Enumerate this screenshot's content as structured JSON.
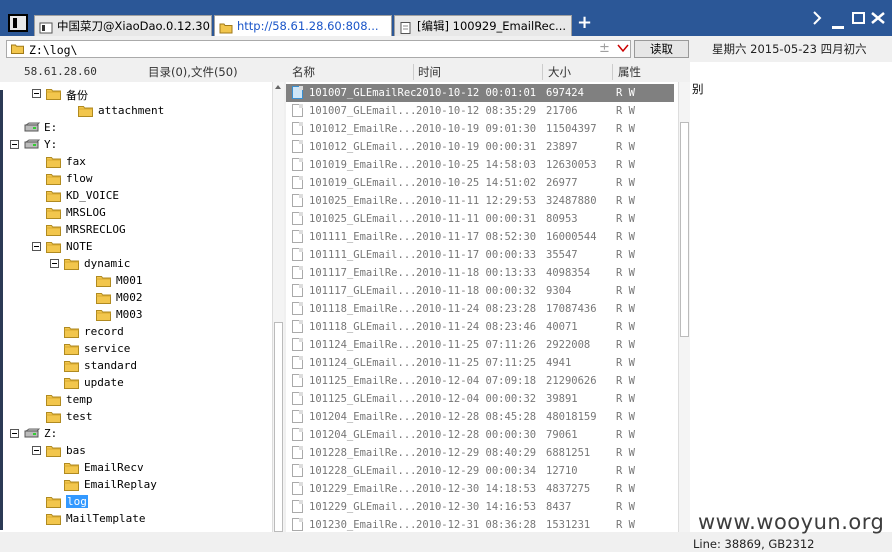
{
  "tabs": [
    {
      "label": "中国菜刀@XiaoDao.0.12.30"
    },
    {
      "label": "http://58.61.28.60:808..."
    },
    {
      "label": "[编辑] 100929_EmailRec..."
    }
  ],
  "tabs_new_label": "+",
  "path": {
    "value": "Z:\\log\\",
    "plus": "±",
    "read_button": "读取"
  },
  "date_text": "星期六 2015-05-23 四月初六",
  "left": {
    "host": "58.61.28.60",
    "dir_status": "目录(0),文件(50)",
    "tree": [
      {
        "label": "备份"
      },
      {
        "label": "attachment"
      },
      {
        "label": "E:"
      },
      {
        "label": "Y:"
      },
      {
        "label": "fax"
      },
      {
        "label": "flow"
      },
      {
        "label": "KD_VOICE"
      },
      {
        "label": "MRSLOG"
      },
      {
        "label": "MRSRECLOG"
      },
      {
        "label": "NOTE"
      },
      {
        "label": "dynamic"
      },
      {
        "label": "M001"
      },
      {
        "label": "M002"
      },
      {
        "label": "M003"
      },
      {
        "label": "record"
      },
      {
        "label": "service"
      },
      {
        "label": "standard"
      },
      {
        "label": "update"
      },
      {
        "label": "temp"
      },
      {
        "label": "test"
      },
      {
        "label": "Z:"
      },
      {
        "label": "bas"
      },
      {
        "label": "EmailRecv"
      },
      {
        "label": "EmailReplay"
      },
      {
        "label": "log"
      },
      {
        "label": "MailTemplate"
      }
    ]
  },
  "list": {
    "columns": [
      "名称",
      "时间",
      "大小",
      "属性"
    ],
    "rows": [
      {
        "name": "101007_GLEmailRec...",
        "time": "2010-10-12 00:01:01",
        "size": "697424",
        "attr": "R W"
      },
      {
        "name": "101007_GLEmail...",
        "time": "2010-10-12 08:35:29",
        "size": "21706",
        "attr": "R W"
      },
      {
        "name": "101012_EmailRe...",
        "time": "2010-10-19 09:01:30",
        "size": "11504397",
        "attr": "R W"
      },
      {
        "name": "101012_GLEmail...",
        "time": "2010-10-19 00:00:31",
        "size": "23897",
        "attr": "R W"
      },
      {
        "name": "101019_EmailRe...",
        "time": "2010-10-25 14:58:03",
        "size": "12630053",
        "attr": "R W"
      },
      {
        "name": "101019_GLEmail...",
        "time": "2010-10-25 14:51:02",
        "size": "26977",
        "attr": "R W"
      },
      {
        "name": "101025_EmailRe...",
        "time": "2010-11-11 12:29:53",
        "size": "32487880",
        "attr": "R W"
      },
      {
        "name": "101025_GLEmail...",
        "time": "2010-11-11 00:00:31",
        "size": "80953",
        "attr": "R W"
      },
      {
        "name": "101111_EmailRe...",
        "time": "2010-11-17 08:52:30",
        "size": "16000544",
        "attr": "R W"
      },
      {
        "name": "101111_GLEmail...",
        "time": "2010-11-17 00:00:33",
        "size": "35547",
        "attr": "R W"
      },
      {
        "name": "101117_EmailRe...",
        "time": "2010-11-18 00:13:33",
        "size": "4098354",
        "attr": "R W"
      },
      {
        "name": "101117_GLEmail...",
        "time": "2010-11-18 00:00:32",
        "size": "9304",
        "attr": "R W"
      },
      {
        "name": "101118_EmailRe...",
        "time": "2010-11-24 08:23:28",
        "size": "17087436",
        "attr": "R W"
      },
      {
        "name": "101118_GLEmail...",
        "time": "2010-11-24 08:23:46",
        "size": "40071",
        "attr": "R W"
      },
      {
        "name": "101124_EmailRe...",
        "time": "2010-11-25 07:11:26",
        "size": "2922008",
        "attr": "R W"
      },
      {
        "name": "101124_GLEmail...",
        "time": "2010-11-25 07:11:25",
        "size": "4941",
        "attr": "R W"
      },
      {
        "name": "101125_EmailRe...",
        "time": "2010-12-04 07:09:18",
        "size": "21290626",
        "attr": "R W"
      },
      {
        "name": "101125_GLEmail...",
        "time": "2010-12-04 00:00:32",
        "size": "39891",
        "attr": "R W"
      },
      {
        "name": "101204_EmailRe...",
        "time": "2010-12-28 08:45:28",
        "size": "48018159",
        "attr": "R W"
      },
      {
        "name": "101204_GLEmail...",
        "time": "2010-12-28 00:00:30",
        "size": "79061",
        "attr": "R W"
      },
      {
        "name": "101228_EmailRe...",
        "time": "2010-12-29 08:40:29",
        "size": "6881251",
        "attr": "R W"
      },
      {
        "name": "101228_GLEmail...",
        "time": "2010-12-29 00:00:34",
        "size": "12710",
        "attr": "R W"
      },
      {
        "name": "101229_EmailRe...",
        "time": "2010-12-30 14:18:53",
        "size": "4837275",
        "attr": "R W"
      },
      {
        "name": "101229_GLEmail...",
        "time": "2010-12-30 14:16:53",
        "size": "8437",
        "attr": "R W"
      },
      {
        "name": "101230_EmailRe...",
        "time": "2010-12-31 08:36:28",
        "size": "1531231",
        "attr": "R W"
      }
    ]
  },
  "right_text": "别",
  "status": "Line: 38869, GB2312",
  "watermark": "www.wooyun.org",
  "colors": {
    "accent": "#2b5797",
    "selection": "#3399ff",
    "row_selected": "#808080",
    "folder": "#f2c64d"
  }
}
